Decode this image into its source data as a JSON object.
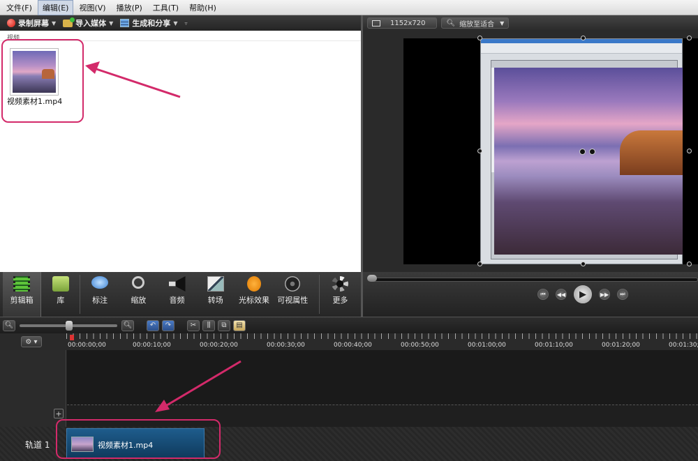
{
  "menu": [
    "文件(F)",
    "编辑(E)",
    "视图(V)",
    "播放(P)",
    "工具(T)",
    "帮助(H)"
  ],
  "toolbar": {
    "record": "录制屏幕",
    "import": "导入媒体",
    "produce": "生成和分享"
  },
  "clip_bin": {
    "section_label": "视频",
    "file_name": "视频素材1.mp4"
  },
  "preview": {
    "dimensions": "1152x720",
    "zoom_label": "缩放至适合"
  },
  "tasks": [
    "剪辑箱",
    "库",
    "标注",
    "缩放",
    "音频",
    "转场",
    "光标效果",
    "可视属性",
    "更多"
  ],
  "timeline": {
    "timecodes": [
      "00:00:00;00",
      "00:00:10;00",
      "00:00:20;00",
      "00:00:30;00",
      "00:00:40;00",
      "00:00:50;00",
      "00:01:00;00",
      "00:01:10;00",
      "00:01:20;00",
      "00:01:30;00"
    ],
    "track_label": "轨道 1",
    "clip_name": "视频素材1.mp4"
  },
  "colors": {
    "highlight": "#d32a6a",
    "clip": "#1e5c8c",
    "record": "#d21a10"
  }
}
